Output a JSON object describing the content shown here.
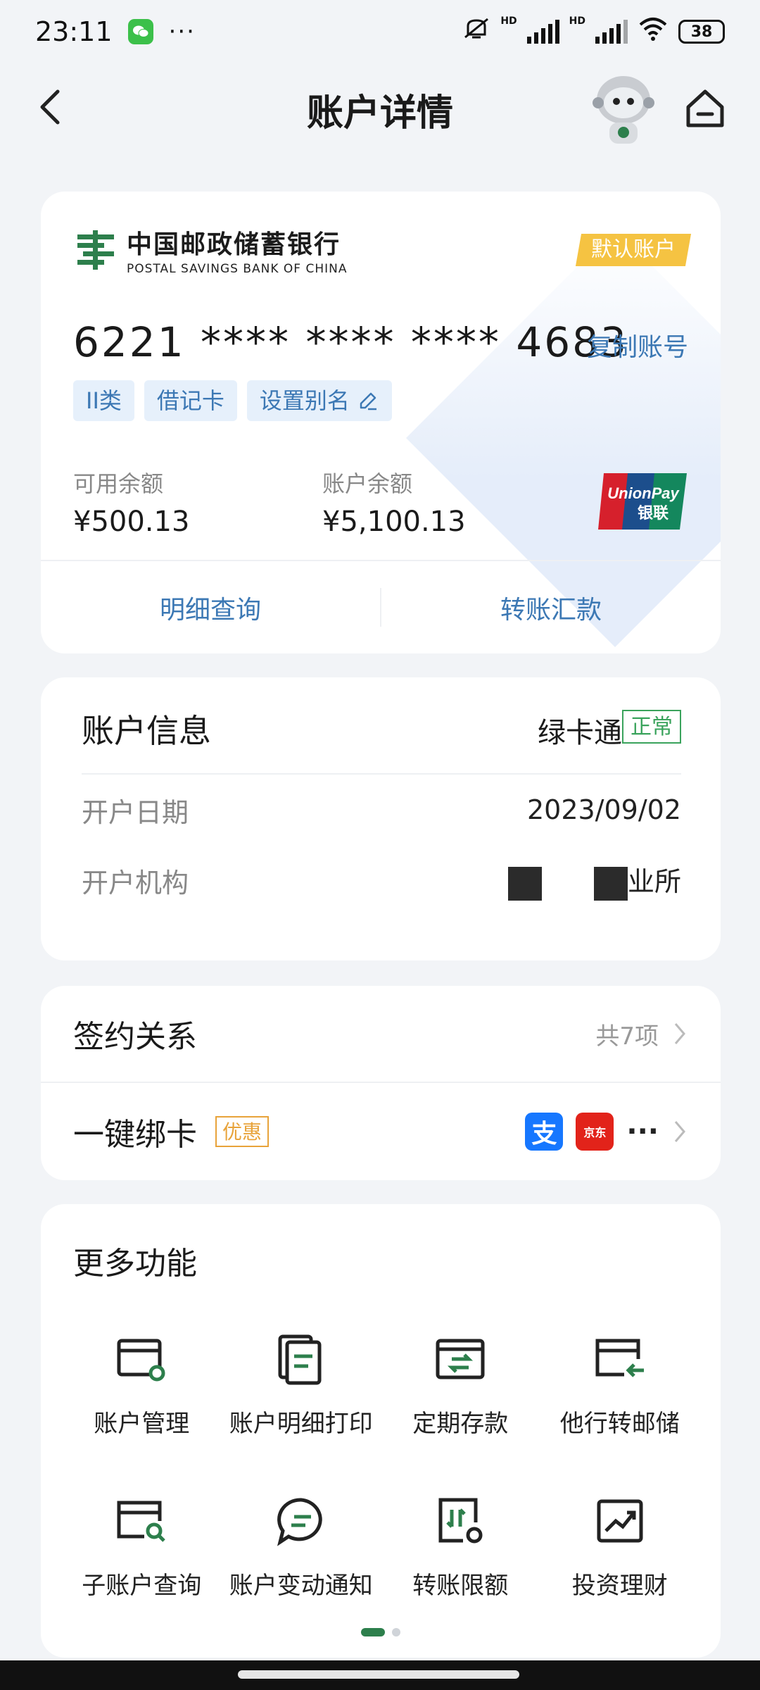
{
  "status_bar": {
    "time": "23:11",
    "dots": "···",
    "battery": "38",
    "hd1": "HD",
    "hd2": "HD"
  },
  "nav": {
    "title": "账户详情"
  },
  "account_card": {
    "bank_name_cn": "中国邮政储蓄银行",
    "bank_name_en": "POSTAL SAVINGS BANK OF CHINA",
    "default_badge": "默认账户",
    "card_number": "6221 **** **** **** 4683",
    "copy_label": "复制账号",
    "tags": [
      "II类",
      "借记卡",
      "设置别名"
    ],
    "available_label": "可用余额",
    "available_value": "¥500.13",
    "balance_label": "账户余额",
    "balance_value": "¥5,100.13",
    "unionpay_text_1": "UnionPay",
    "unionpay_text_2": "银联",
    "actions": [
      "明细查询",
      "转账汇款"
    ]
  },
  "account_info": {
    "title": "账户信息",
    "card_type": "绿卡通",
    "status": "正常",
    "open_date_label": "开户日期",
    "open_date_value": "2023/09/02",
    "open_branch_label": "开户机构",
    "open_branch_value_suffix": "业所"
  },
  "relations": {
    "sign_label": "签约关系",
    "sign_count": "共7项",
    "bind_label": "一键绑卡",
    "promo": "优惠",
    "alipay_glyph": "支",
    "jd_glyph": "京东",
    "more": "···"
  },
  "more_functions": {
    "title": "更多功能",
    "items": [
      {
        "label": "账户管理",
        "icon": "card-gear-icon"
      },
      {
        "label": "账户明细打印",
        "icon": "document-print-icon"
      },
      {
        "label": "定期存款",
        "icon": "term-deposit-icon"
      },
      {
        "label": "他行转邮储",
        "icon": "card-transfer-in-icon"
      },
      {
        "label": "子账户查询",
        "icon": "card-search-icon"
      },
      {
        "label": "账户变动通知",
        "icon": "message-bubble-icon"
      },
      {
        "label": "转账限额",
        "icon": "transfer-limit-icon"
      },
      {
        "label": "投资理财",
        "icon": "investment-chart-icon"
      }
    ]
  },
  "colors": {
    "accent_blue": "#3c78b4",
    "brand_green": "#2d7f4c",
    "badge_yellow": "#f5c342",
    "status_green": "#3aa35c",
    "promo_orange": "#e8a33a"
  }
}
